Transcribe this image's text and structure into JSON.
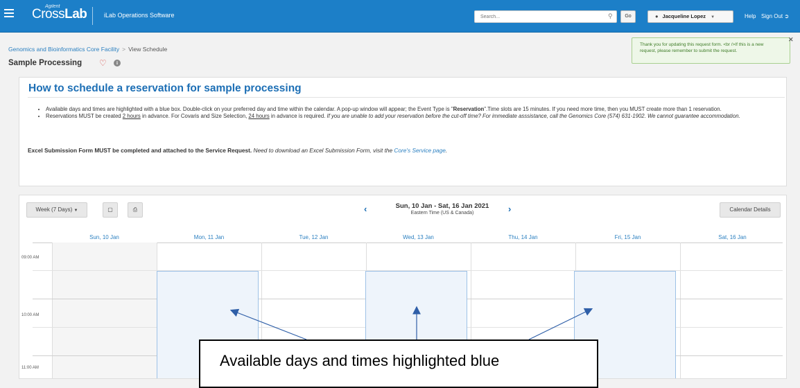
{
  "topbar": {
    "brand_small": "Agilent",
    "brand_cross": "Cross",
    "brand_lab": "Lab",
    "app_name": "iLab Operations Software",
    "search_placeholder": "Search...",
    "go_label": "Go",
    "user_name": "Jacqueline Lopez",
    "help_label": "Help",
    "signout_label": "Sign Out"
  },
  "breadcrumb": {
    "facility": "Genomics and Bioinformatics Core Facility",
    "separator": ">",
    "current": "View Schedule"
  },
  "page_title": "Sample Processing",
  "notice": "Thank you for updating this request form. <br />If this is a new request, please remember to submit the request.",
  "instructions": {
    "heading": "How to schedule a reservation for sample processing",
    "b1_a": "Available days and times are highlighted with a blue box. Double-click on your preferred day and time within the calendar. A pop-up window will appear; the Event Type is \"",
    "b1_bold": "Reservation",
    "b1_b": "\".Time slots are 15 minutes. If you need more time, then you MUST create more than 1 reservation.",
    "b2_a": "Reservations MUST be created ",
    "b2_u1": "2 hours",
    "b2_b": " in advance. For Covaris and Size Selection, ",
    "b2_u2": "24 hours",
    "b2_c": " in advance is required. ",
    "b2_italic": "If you are unable to add your reservation before the cut-off time? For immediate asssistance, call the Genomics Core (574) 631-1902. We cannot guarantee accommodation.",
    "excel_bold": "Excel Submission Form MUST be completed and attached to the Service Request.",
    "excel_italic": " Need to download an Excel Submission Form, visit the ",
    "excel_link": "Core's Service page",
    "excel_end": "."
  },
  "calendar": {
    "view_label": "Week (7 Days)",
    "date_range": "Sun, 10 Jan - Sat, 16 Jan 2021",
    "timezone": "Eastern Time (US & Canada)",
    "details_label": "Calendar Details",
    "days": [
      "Sun, 10 Jan",
      "Mon, 11 Jan",
      "Tue, 12 Jan",
      "Wed, 13 Jan",
      "Thu, 14 Jan",
      "Fri, 15 Jan",
      "Sat, 16 Jan"
    ],
    "times": [
      "09:00 AM",
      "10:00 AM",
      "11:00 AM"
    ],
    "available_days": [
      "Mon, 11 Jan",
      "Wed, 13 Jan",
      "Fri, 15 Jan"
    ],
    "available_color": "#eef4fb",
    "accent": "#1c7fc8"
  },
  "annotation": "Available days and times highlighted blue"
}
